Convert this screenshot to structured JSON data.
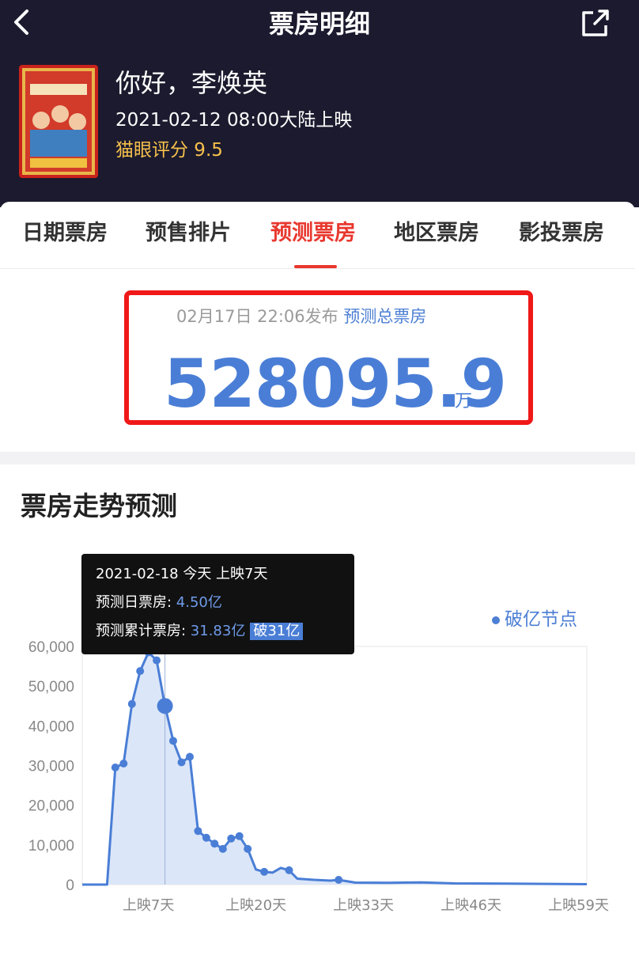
{
  "header": {
    "title": "票房明细",
    "back_icon": "chevron-left-icon",
    "share_icon": "share-external-icon"
  },
  "movie": {
    "name": "你好，李焕英",
    "release": "2021-02-12 08:00大陆上映",
    "rating": "猫眼评分 9.5"
  },
  "tabs": [
    {
      "label": "日期票房",
      "active": false
    },
    {
      "label": "预售排片",
      "active": false
    },
    {
      "label": "预测票房",
      "active": true
    },
    {
      "label": "地区票房",
      "active": false
    },
    {
      "label": "影投票房",
      "active": false
    }
  ],
  "forecast": {
    "publish_time": "02月17日 22:06发布",
    "link": "预测总票房",
    "total": "528095.9",
    "unit": "万"
  },
  "trend": {
    "title": "票房走势预测",
    "legend": "破亿节点"
  },
  "tooltip": {
    "line1": "2021-02-18 今天 上映7天",
    "daily_label": "预测日票房: ",
    "daily_value": "4.50亿",
    "cum_label": "预测累计票房: ",
    "cum_value": "31.83亿",
    "badge": "破31亿"
  },
  "colors": {
    "accent_red": "#e8382f",
    "chart_blue": "#4a7ed6",
    "header_bg": "#1c1a2e",
    "rating_gold": "#f5c04c"
  },
  "chart_data": {
    "type": "area",
    "ylim": [
      0,
      60000
    ],
    "y_ticks": [
      "60,000",
      "50,000",
      "40,000",
      "30,000",
      "20,000",
      "10,000",
      "0"
    ],
    "x_tick_labels": [
      "上映7天",
      "上映20天",
      "上映33天",
      "上映46天",
      "上映59天"
    ],
    "x_tick_days": [
      7,
      20,
      33,
      46,
      59
    ],
    "highlight_day": 9,
    "series": [
      {
        "values": [
          {
            "day": -1,
            "y": 0
          },
          {
            "day": 2,
            "y": 0
          },
          {
            "day": 3,
            "y": 29500
          },
          {
            "day": 4,
            "y": 30500
          },
          {
            "day": 5,
            "y": 45500
          },
          {
            "day": 6,
            "y": 53800
          },
          {
            "day": 7,
            "y": 58500
          },
          {
            "day": 8,
            "y": 56500
          },
          {
            "day": 9,
            "y": 45000,
            "marker": "large"
          },
          {
            "day": 10,
            "y": 36200
          },
          {
            "day": 11,
            "y": 30800
          },
          {
            "day": 12,
            "y": 32200
          },
          {
            "day": 13,
            "y": 13500
          },
          {
            "day": 14,
            "y": 11800
          },
          {
            "day": 15,
            "y": 10300
          },
          {
            "day": 16,
            "y": 9000
          },
          {
            "day": 17,
            "y": 11600
          },
          {
            "day": 18,
            "y": 12200
          },
          {
            "day": 19,
            "y": 9000
          },
          {
            "day": 20,
            "y": 3800
          },
          {
            "day": 21,
            "y": 3200
          },
          {
            "day": 22,
            "y": 3000
          },
          {
            "day": 23,
            "y": 4200
          },
          {
            "day": 24,
            "y": 3600
          },
          {
            "day": 25,
            "y": 1500
          },
          {
            "day": 27,
            "y": 1200
          },
          {
            "day": 29,
            "y": 1000
          },
          {
            "day": 30,
            "y": 1200
          },
          {
            "day": 32,
            "y": 500
          },
          {
            "day": 36,
            "y": 450
          },
          {
            "day": 40,
            "y": 550
          },
          {
            "day": 44,
            "y": 300
          },
          {
            "day": 50,
            "y": 250
          },
          {
            "day": 60,
            "y": 100
          }
        ],
        "dot_days": [
          3,
          4,
          5,
          6,
          7,
          8,
          9,
          10,
          11,
          12,
          13,
          14,
          15,
          16,
          17,
          18,
          19,
          21,
          24,
          30
        ]
      }
    ]
  }
}
